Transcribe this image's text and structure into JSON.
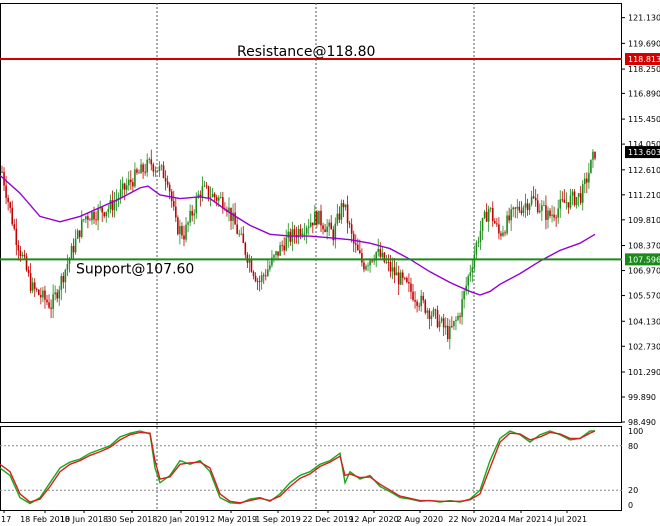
{
  "chart_data": [
    {
      "type": "candlestick",
      "title": "",
      "x_tick_labels": [
        "17",
        "18 Feb 2018",
        "10 Jun 2018",
        "30 Sep 2018",
        "20 Jan 2019",
        "12 May 2019",
        "1 Sep 2019",
        "22 Dec 2019",
        "12 Apr 2020",
        "2 Aug 2020",
        "22 Nov 2020",
        "14 Mar 2021",
        "4 Jul 2021"
      ],
      "y_tick_labels": [
        "121.130",
        "119.690",
        "118.250",
        "116.890",
        "115.450",
        "114.050",
        "112.610",
        "111.210",
        "109.810",
        "108.370",
        "106.970",
        "105.570",
        "104.130",
        "102.730",
        "101.290",
        "99.890",
        "98.490"
      ],
      "ylim": [
        98.49,
        121.95
      ],
      "grid": false,
      "last_price": 113.603,
      "last_price_label": "113.603",
      "series": [
        {
          "name": "",
          "type": "line",
          "color": "#9400d3",
          "x": [
            0,
            20,
            40,
            60,
            80,
            100,
            120,
            140,
            148,
            160,
            180,
            200,
            210,
            230,
            250,
            270,
            290,
            310,
            330,
            350,
            370,
            390,
            410,
            430,
            450,
            470,
            480,
            490,
            500,
            520,
            540,
            560,
            580,
            595
          ],
          "y": [
            112.3,
            111.3,
            110.0,
            109.7,
            110.0,
            110.5,
            111.0,
            111.6,
            111.7,
            111.2,
            111.0,
            111.1,
            111.0,
            110.2,
            109.5,
            109.0,
            108.9,
            108.9,
            108.8,
            108.7,
            108.5,
            108.2,
            107.6,
            106.9,
            106.3,
            105.8,
            105.6,
            105.8,
            106.2,
            106.8,
            107.5,
            108.1,
            108.5,
            109.0
          ]
        }
      ],
      "levels": [
        {
          "label": "Resistance@118.80",
          "value": 118.813,
          "value_label": "118.813",
          "color": "#d40000"
        },
        {
          "label": "Support@107.60",
          "value": 107.596,
          "value_label": "107.596",
          "color": "#1a8a1a"
        }
      ]
    },
    {
      "type": "line",
      "title": "",
      "y_tick_labels": [
        "100",
        "80",
        "20",
        "0"
      ],
      "ylim": [
        0,
        100
      ],
      "levels": [
        80,
        20
      ],
      "series": [
        {
          "name": "",
          "color": "#19a819",
          "x": [
            0,
            10,
            20,
            30,
            40,
            50,
            60,
            70,
            80,
            90,
            100,
            110,
            120,
            130,
            140,
            150,
            155,
            160,
            170,
            180,
            190,
            200,
            210,
            220,
            230,
            240,
            250,
            260,
            270,
            280,
            290,
            300,
            310,
            320,
            330,
            340,
            345,
            350,
            360,
            370,
            380,
            390,
            400,
            410,
            420,
            430,
            440,
            450,
            460,
            470,
            480,
            490,
            500,
            510,
            520,
            530,
            540,
            550,
            560,
            570,
            580,
            590,
            595
          ],
          "y": [
            50,
            40,
            10,
            2,
            10,
            30,
            50,
            58,
            62,
            70,
            75,
            80,
            92,
            97,
            100,
            96,
            50,
            30,
            40,
            60,
            55,
            60,
            45,
            10,
            3,
            2,
            8,
            10,
            5,
            15,
            30,
            40,
            45,
            55,
            60,
            70,
            30,
            45,
            35,
            40,
            25,
            18,
            10,
            8,
            5,
            6,
            4,
            6,
            4,
            8,
            20,
            60,
            90,
            100,
            95,
            85,
            95,
            100,
            95,
            88,
            90,
            100,
            100
          ]
        },
        {
          "name": "",
          "color": "#d42020",
          "x": [
            0,
            10,
            20,
            30,
            40,
            50,
            60,
            70,
            80,
            90,
            100,
            110,
            120,
            130,
            140,
            150,
            155,
            160,
            170,
            180,
            190,
            200,
            210,
            220,
            230,
            240,
            250,
            260,
            270,
            280,
            290,
            300,
            310,
            320,
            330,
            340,
            345,
            350,
            360,
            370,
            380,
            390,
            400,
            410,
            420,
            430,
            440,
            450,
            460,
            470,
            480,
            490,
            500,
            510,
            520,
            530,
            540,
            550,
            560,
            570,
            580,
            590,
            595
          ],
          "y": [
            55,
            45,
            15,
            4,
            8,
            25,
            45,
            55,
            60,
            67,
            72,
            78,
            88,
            95,
            98,
            97,
            60,
            35,
            38,
            55,
            57,
            58,
            50,
            15,
            5,
            3,
            6,
            9,
            6,
            12,
            25,
            36,
            42,
            52,
            58,
            66,
            40,
            42,
            37,
            38,
            28,
            20,
            12,
            9,
            6,
            6,
            5,
            5,
            5,
            7,
            15,
            50,
            85,
            97,
            96,
            88,
            92,
            98,
            96,
            90,
            90,
            97,
            100
          ]
        }
      ]
    }
  ]
}
